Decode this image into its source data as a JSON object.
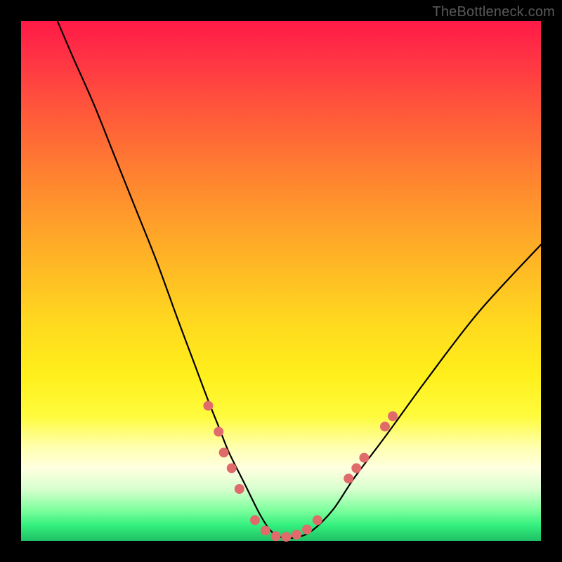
{
  "watermark": {
    "text": "TheBottleneck.com"
  },
  "colors": {
    "black": "#000000",
    "curve_stroke": "#000000",
    "marker_fill": "#e06b6b",
    "marker_stroke": "#c94f4f"
  },
  "chart_data": {
    "type": "line",
    "title": "",
    "xlabel": "",
    "ylabel": "",
    "xlim": [
      0,
      100
    ],
    "ylim": [
      0,
      100
    ],
    "grid": false,
    "legend": false,
    "note": "No axis ticks or numeric labels are rendered; values are pixel-proportional estimates of the black curve (y high = top).",
    "series": [
      {
        "name": "curve",
        "x": [
          7,
          10,
          14,
          18,
          22,
          26,
          30,
          33,
          36,
          38,
          40,
          43,
          46,
          48,
          50,
          53,
          56,
          60,
          64,
          70,
          78,
          88,
          100
        ],
        "y": [
          100,
          93,
          84,
          74,
          64,
          54,
          43,
          35,
          27,
          22,
          17,
          11,
          5,
          2,
          0.7,
          0.7,
          2,
          6,
          12,
          20,
          31,
          44,
          57
        ]
      }
    ],
    "markers": {
      "note": "Salmon dots near the valley; estimated percent coords.",
      "points": [
        {
          "x": 36,
          "y": 26
        },
        {
          "x": 38,
          "y": 21
        },
        {
          "x": 39,
          "y": 17
        },
        {
          "x": 40.5,
          "y": 14
        },
        {
          "x": 42,
          "y": 10
        },
        {
          "x": 45,
          "y": 4
        },
        {
          "x": 47,
          "y": 2
        },
        {
          "x": 49,
          "y": 0.9
        },
        {
          "x": 51,
          "y": 0.8
        },
        {
          "x": 53,
          "y": 1.2
        },
        {
          "x": 55,
          "y": 2.2
        },
        {
          "x": 57,
          "y": 4
        },
        {
          "x": 63,
          "y": 12
        },
        {
          "x": 64.5,
          "y": 14
        },
        {
          "x": 66,
          "y": 16
        },
        {
          "x": 70,
          "y": 22
        },
        {
          "x": 71.5,
          "y": 24
        }
      ]
    }
  }
}
